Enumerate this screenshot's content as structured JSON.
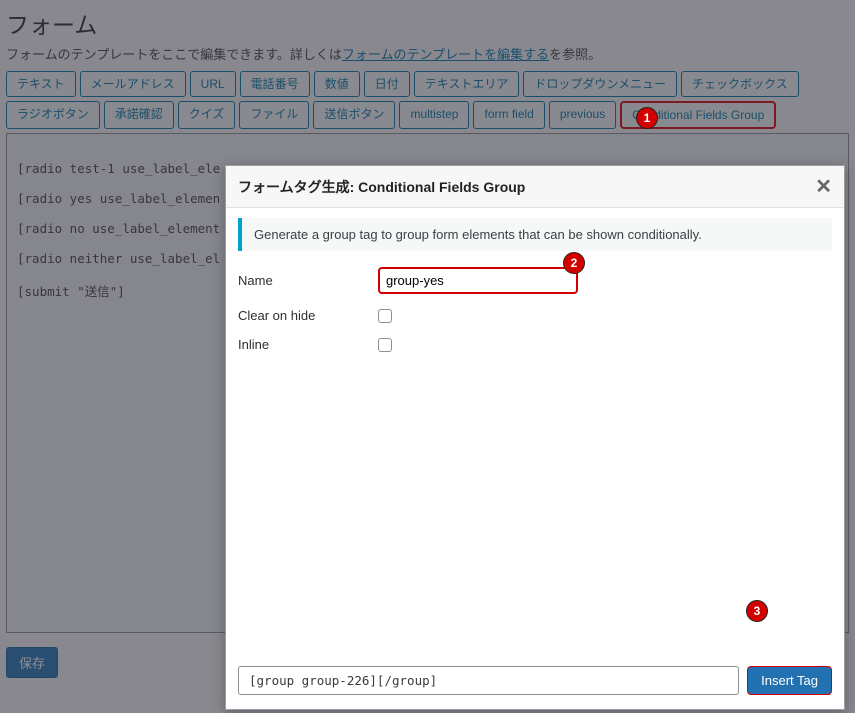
{
  "page": {
    "title": "フォーム",
    "desc_prefix": "フォームのテンプレートをここで編集できます。詳しくは",
    "desc_link": "フォームのテンプレートを編集する",
    "desc_suffix": "を参照。"
  },
  "tagButtons": [
    "テキスト",
    "メールアドレス",
    "URL",
    "電話番号",
    "数値",
    "日付",
    "テキストエリア",
    "ドロップダウンメニュー",
    "チェックボックス",
    "ラジオボタン",
    "承諾確認",
    "クイズ",
    "ファイル",
    "送信ボタン",
    "multistep",
    "form field",
    "previous",
    "Conditional Fields Group"
  ],
  "highlightTagIndex": 17,
  "editor": {
    "line1": "[radio test-1 use_label_ele",
    "line2": "[radio yes use_label_elemen",
    "line3": "[radio no use_label_element",
    "line4": "[radio neither use_label_el",
    "line5": "[submit \"送信\"]"
  },
  "saveLabel": "保存",
  "modal": {
    "title": "フォームタグ生成: Conditional Fields Group",
    "close": "✕",
    "notice": "Generate a group tag to group form elements that can be shown conditionally.",
    "nameLabel": "Name",
    "nameValue": "group-yes",
    "clearLabel": "Clear on hide",
    "inlineLabel": "Inline",
    "output": "[group group-226][/group]",
    "insertLabel": "Insert Tag"
  },
  "markers": {
    "m1": "1",
    "m2": "2",
    "m3": "3"
  }
}
